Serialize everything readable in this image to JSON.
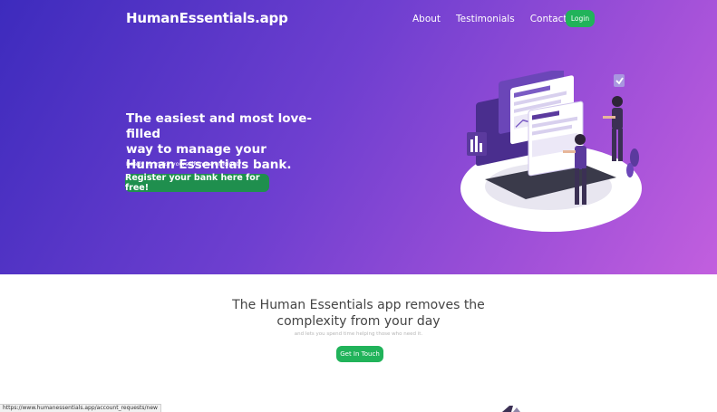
{
  "header": {
    "brand": "HumanEssentials.app",
    "nav": [
      {
        "label": "About"
      },
      {
        "label": "Testimonials"
      },
      {
        "label": "Contact"
      }
    ],
    "login_label": "Login"
  },
  "hero": {
    "headline_lines": [
      "The easiest and most love-filled",
      "way to manage your",
      "Human Essentials bank."
    ],
    "subline": "Ready to make yourself more efficient?",
    "register_label": "Register your bank here for free!",
    "gradient_colors": [
      "#3d2bbd",
      "#6f3fd0",
      "#a552d9",
      "#c25fde"
    ]
  },
  "intro": {
    "title_lines": [
      "The Human Essentials app removes the",
      "complexity from your day"
    ],
    "subtitle": "and lets you spend time helping those who need it.",
    "cta_label": "Get In Touch"
  },
  "status_bar": {
    "url": "https://www.humanessentials.app/account_requests/new"
  },
  "colors": {
    "accent_green": "#21b35a",
    "register_green": "#1f8f4e",
    "illustration_purple": "#5b3a9e"
  },
  "icons": {
    "illustration": "dashboard-people-illustration"
  }
}
